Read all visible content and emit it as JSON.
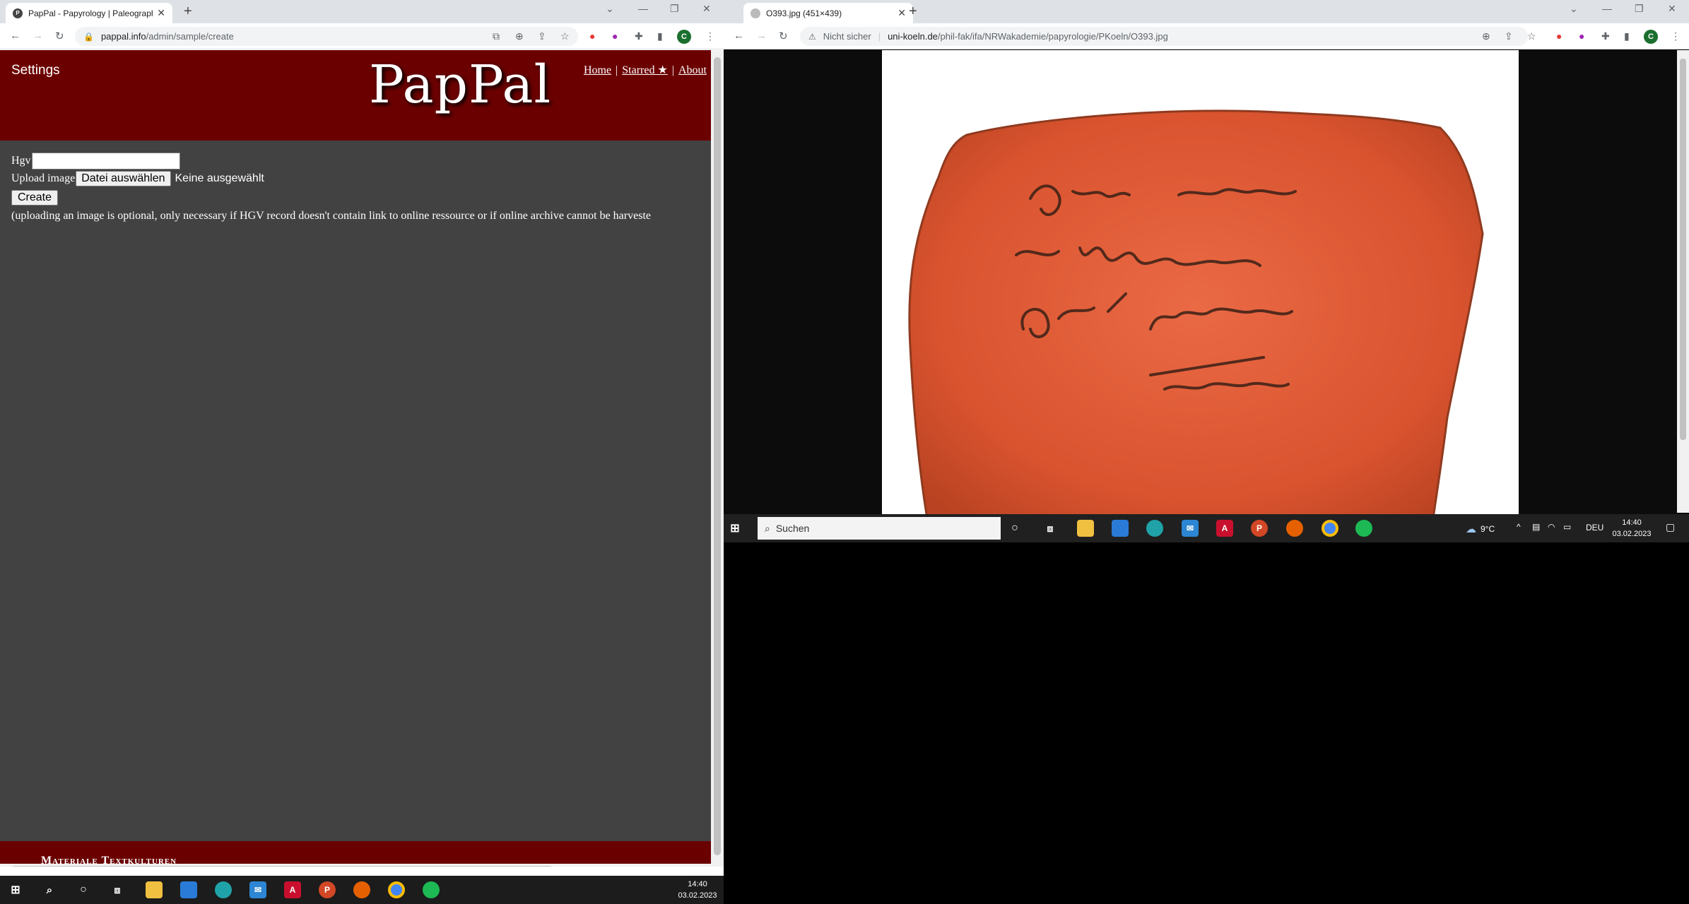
{
  "left_window": {
    "tab": {
      "favicon": "pappal-logo-icon",
      "title": "PapPal - Papyrology | Paleography"
    },
    "url": {
      "host": "pappal.info",
      "path": "/admin/sample/create"
    },
    "page": {
      "settings_label": "Settings",
      "logo_text": "PapPal",
      "nav": {
        "home": "Home",
        "starred": "Starred ★",
        "about": "About",
        "separator": "|"
      },
      "form": {
        "hgv_label": "Hgv",
        "upload_label": "Upload image",
        "file_button": "Datei auswählen",
        "file_status": "Keine ausgewählt",
        "create_button": "Create",
        "note": "(uploading an image is optional, only necessary if HGV record doesn't contain link to online ressource or if online archive cannot be harveste"
      },
      "footer_text": "Materiale Textkulturen"
    }
  },
  "right_window": {
    "tab": {
      "title": "O393.jpg (451×439)"
    },
    "url": {
      "security": "Nicht sicher",
      "host": "uni-koeln.de",
      "path": "/phil-fak/ifa/NRWakademie/papyrologie/PKoeln/O393.jpg"
    }
  },
  "taskbar_right": {
    "search_placeholder": "Suchen",
    "weather": "9°C",
    "language": "DEU",
    "time": "14:40",
    "date": "03.02.2023"
  },
  "taskbar_left": {
    "time": "14:40",
    "date": "03.02.2023"
  },
  "colors": {
    "brand": "#6b0000",
    "page_bg": "#424242"
  }
}
